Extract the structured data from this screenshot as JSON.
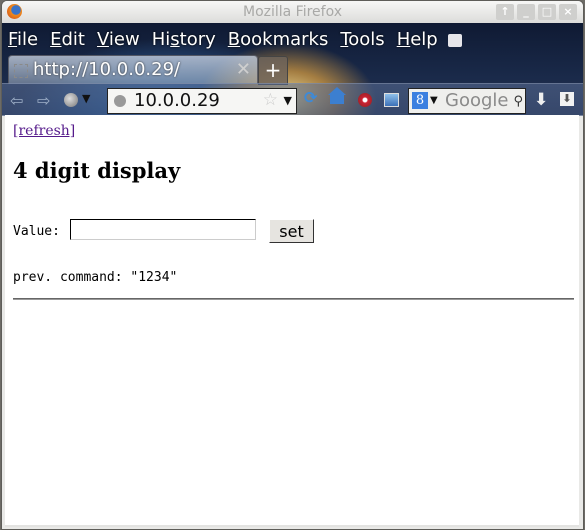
{
  "window": {
    "title": "Mozilla Firefox",
    "controls": [
      "up-icon",
      "minimize-icon",
      "maximize-icon",
      "close-icon"
    ],
    "control_glyphs": [
      "↑",
      "_",
      "□",
      "×"
    ]
  },
  "menubar": {
    "items": [
      {
        "label": "File",
        "accel": "F"
      },
      {
        "label": "Edit",
        "accel": "E"
      },
      {
        "label": "View",
        "accel": "V"
      },
      {
        "label": "History",
        "accel": "s"
      },
      {
        "label": "Bookmarks",
        "accel": "B"
      },
      {
        "label": "Tools",
        "accel": "T"
      },
      {
        "label": "Help",
        "accel": "H"
      }
    ]
  },
  "tabs": [
    {
      "title": "http://10.0.0.29/",
      "close_glyph": "✕",
      "active": true
    }
  ],
  "newtab_glyph": "+",
  "navbar": {
    "back_glyph": "⇦",
    "forward_glyph": "⇨",
    "url": "10.0.0.29",
    "star_glyph": "☆",
    "dropdown_glyph": "▼",
    "reload_glyph": "⟳",
    "search_placeholder": "Google",
    "search_engine_glyph": "8",
    "binoculars_glyph": "⚲",
    "download_glyph": "⬇",
    "menu_glyph": "⬇"
  },
  "page": {
    "refresh_link": "[refresh]",
    "heading": "4 digit display",
    "value_label": "Value:",
    "value_input": "",
    "set_button": "set",
    "prev_command": "prev. command: \"1234\""
  }
}
